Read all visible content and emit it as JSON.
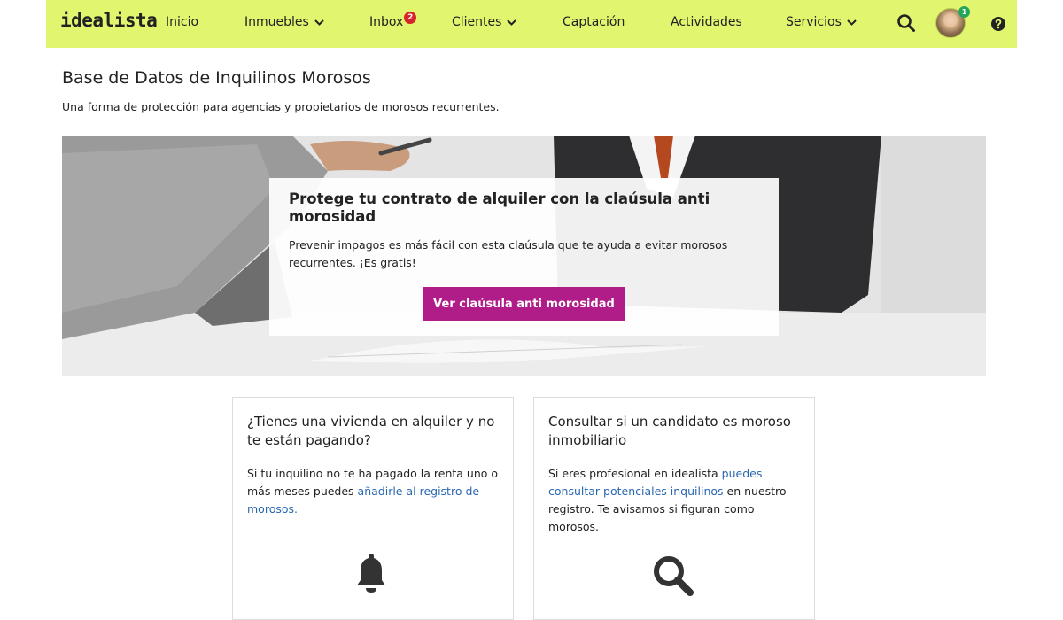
{
  "nav": {
    "logo": "idealista",
    "items": [
      {
        "label": "Inicio"
      },
      {
        "label": "Inmuebles"
      },
      {
        "label": "Inbox"
      },
      {
        "label": "Clientes"
      },
      {
        "label": "Captación"
      },
      {
        "label": "Actividades"
      },
      {
        "label": "Servicios"
      }
    ],
    "inbox_badge": "2",
    "avatar_badge": "1",
    "icons": [
      "chevron-down-icon",
      "search-icon",
      "avatar",
      "help-icon"
    ],
    "background_color": "#e1f56e",
    "badge_color": "#d8232a"
  },
  "page": {
    "title": "Base de Datos de Inquilinos Morosos",
    "subtitle": "Una forma de protección para agencias y propietarios de morosos recurrentes."
  },
  "hero": {
    "heading": "Protege tu contrato de alquiler con la claúsula anti morosidad",
    "text": "Prevenir impagos es más fácil con esta claúsula que te ayuda a evitar morosos recurrentes. ¡Es gratis!",
    "button_label": "Ver claúsula anti morosidad",
    "button_color": "#b01c88"
  },
  "cards": [
    {
      "title": "¿Tienes una vivienda en alquiler y no te están pagando?",
      "text_before": "Si tu inquilino no te ha pagado la renta uno o más meses puedes ",
      "link_text": "añadirle al registro de morosos.",
      "text_after": "",
      "icon": "bell-icon"
    },
    {
      "title": "Consultar si un candidato es moroso inmobiliario",
      "text_before": "Si eres profesional en idealista ",
      "link_text": "puedes consultar potenciales inquilinos",
      "text_after": " en nuestro registro. Te avisamos si figuran como morosos.",
      "icon": "search-icon"
    }
  ],
  "link_color": "#2a67b1"
}
